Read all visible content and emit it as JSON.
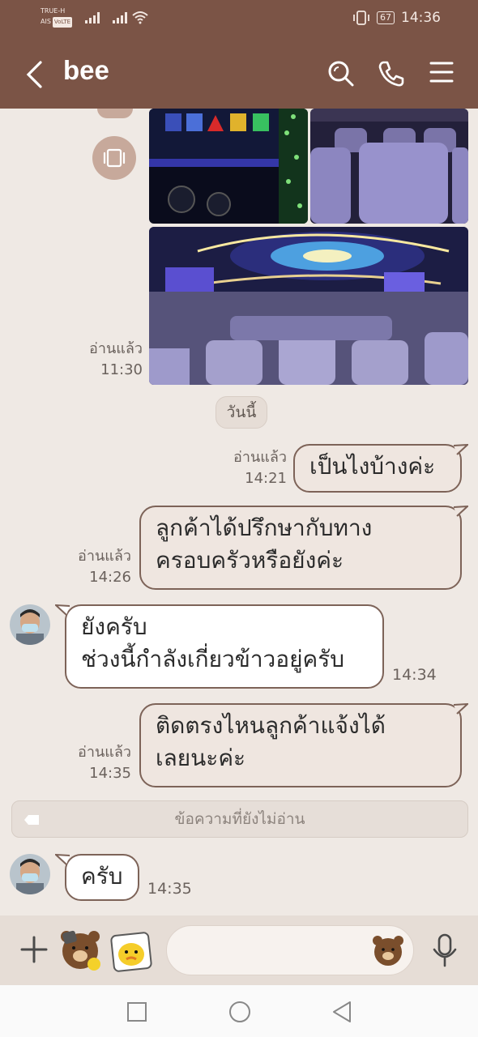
{
  "status": {
    "carrier": "TRUE-H",
    "carrier2": "AIS",
    "volte": "VoLTE",
    "battery": "67",
    "time": "14:36"
  },
  "header": {
    "title": "bee"
  },
  "chat": {
    "image_msg": {
      "read": "อ่านแล้ว",
      "time": "11:30"
    },
    "date_chip": "วันนี้",
    "messages": [
      {
        "side": "right",
        "text1": "เป็นไงบ้างค่ะ",
        "text2": "",
        "read": "อ่านแล้ว",
        "time": "14:21"
      },
      {
        "side": "right",
        "text1": "ลูกค้าได้ปรึกษากับทาง",
        "text2": "ครอบครัวหรือยังค่ะ",
        "read": "อ่านแล้ว",
        "time": "14:26"
      },
      {
        "side": "left",
        "text1": "ยังครับ",
        "text2": "ช่วงนี้กำลังเกี่ยวข้าวอยู่ครับ",
        "time": "14:34"
      },
      {
        "side": "right",
        "text1": "ติดตรงไหนลูกค้าแจ้งได้",
        "text2": "เลยนะค่ะ",
        "read": "อ่านแล้ว",
        "time": "14:35"
      },
      {
        "side": "left",
        "text1": "ครับ",
        "text2": "",
        "time": "14:35"
      }
    ],
    "unread_divider": "ข้อความที่ยังไม่อ่าน"
  },
  "input": {
    "placeholder": ""
  },
  "icons": [
    "back-icon",
    "search-icon",
    "phone-icon",
    "menu-icon",
    "plus-icon",
    "sticker-icon",
    "emoji-icon",
    "microphone-icon",
    "album-icon"
  ],
  "colors": {
    "header": "#7b5446",
    "background": "#efe9e4",
    "bubble_border": "#7d6358"
  }
}
